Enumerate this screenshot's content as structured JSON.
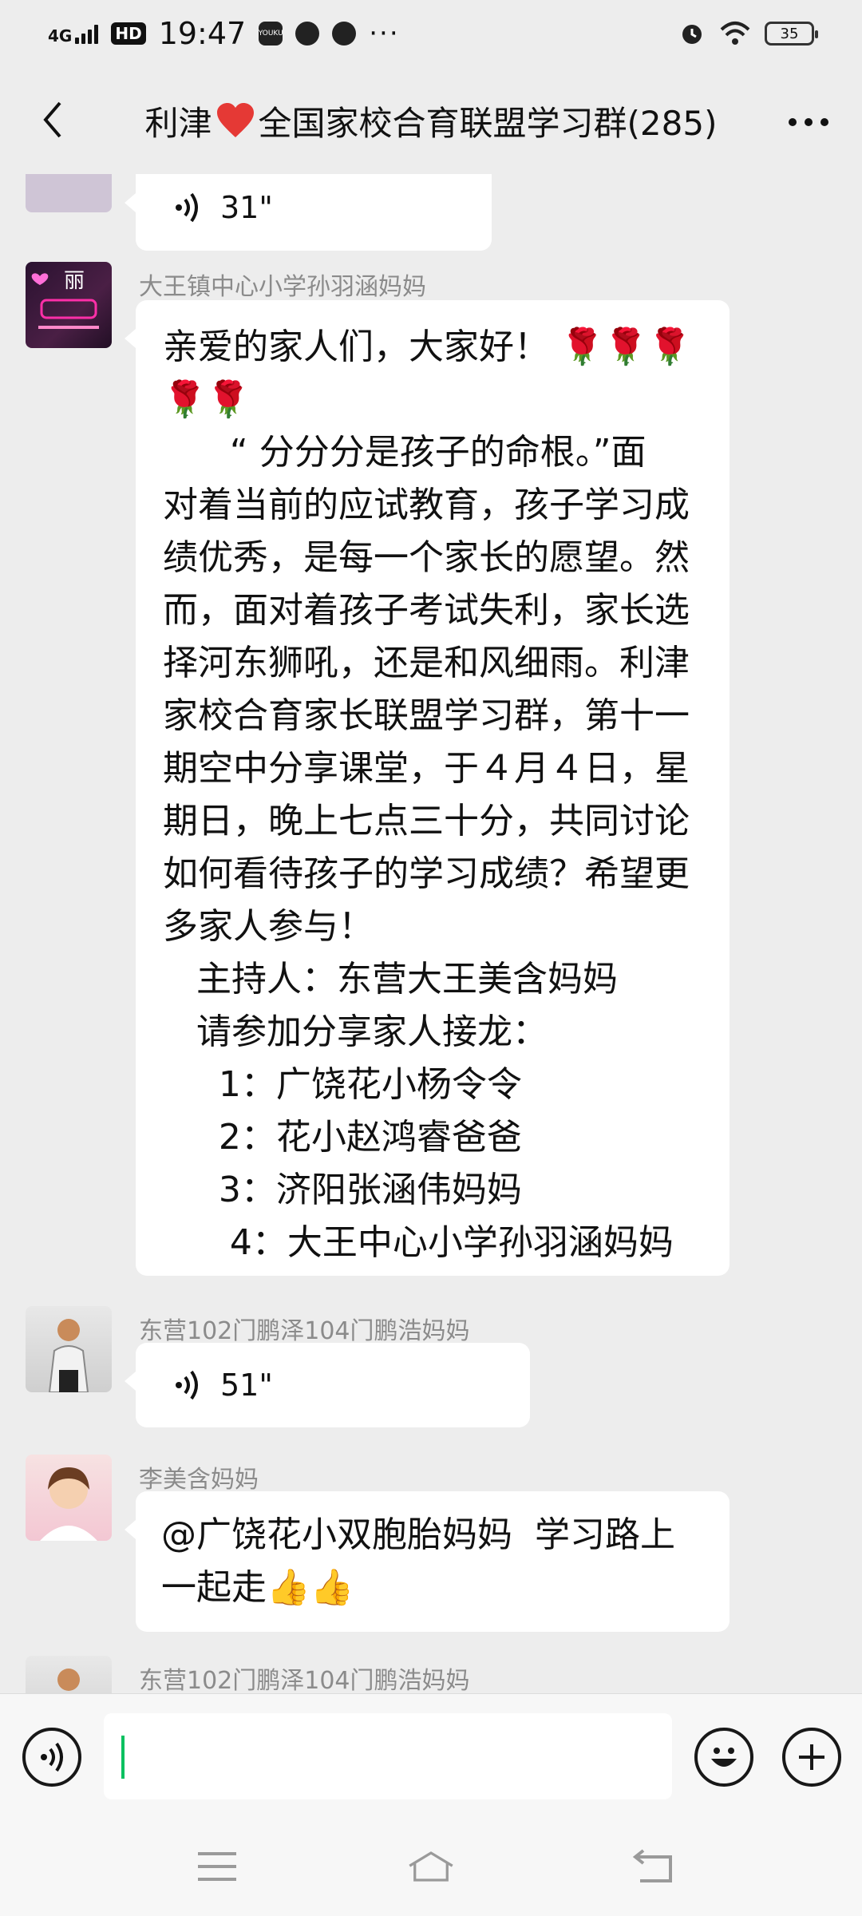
{
  "status_bar": {
    "network": "4G",
    "hd": "HD",
    "time": "19:47",
    "app_badge": "YOUKU",
    "more": "···",
    "battery": "35"
  },
  "header": {
    "title_prefix": "利津",
    "title_suffix": "全国家校合育联盟学习群(285)"
  },
  "messages": [
    {
      "duration": "31\""
    },
    {
      "name": "大王镇中心小学孙羽涵妈妈",
      "lines": [
        "亲爱的家人们，大家好！",
        "",
        "      “ 分分分是孩子的命根。”面",
        "对着当前的应试教育，孩子学习成",
        "绩优秀，是每一个家长的愿望。然",
        "而，面对着孩子考试失利，家长选",
        "择河东狮吼，还是和风细雨。利津",
        "家校合育家长联盟学习群，第十一",
        "期空中分享课堂，于４月４日，星",
        "期日，晚上七点三十分，共同讨论",
        "如何看待孩子的学习成绩？希望更",
        "多家人参与！",
        "   主持人：东营大王美含妈妈",
        "   请参加分享家人接龙：",
        "     1：广饶花小杨令令",
        "     2：花小赵鸿睿爸爸",
        "     3：济阳张涵伟妈妈",
        "      4：大王中心小学孙羽涵妈妈"
      ],
      "flowers_line1": "🌹🌹🌹",
      "flowers_line2": "🌹🌹"
    },
    {
      "name": "东营102门鹏泽104门鹏浩妈妈",
      "duration": "51\""
    },
    {
      "name": "李美含妈妈",
      "line1": "@广饶花小双胞胎妈妈  学习路上",
      "line2": "一起走👍👍"
    },
    {
      "name": "东营102门鹏泽104门鹏浩妈妈"
    }
  ],
  "colors": {
    "accent": "#07c160",
    "background": "#ededed",
    "bubble": "#ffffff",
    "name": "#8b8b8b"
  },
  "icons": [
    "back-arrow-icon",
    "more-icon",
    "voice-icon",
    "emoji-icon",
    "plus-icon",
    "menu-icon",
    "home-icon",
    "back-icon"
  ]
}
